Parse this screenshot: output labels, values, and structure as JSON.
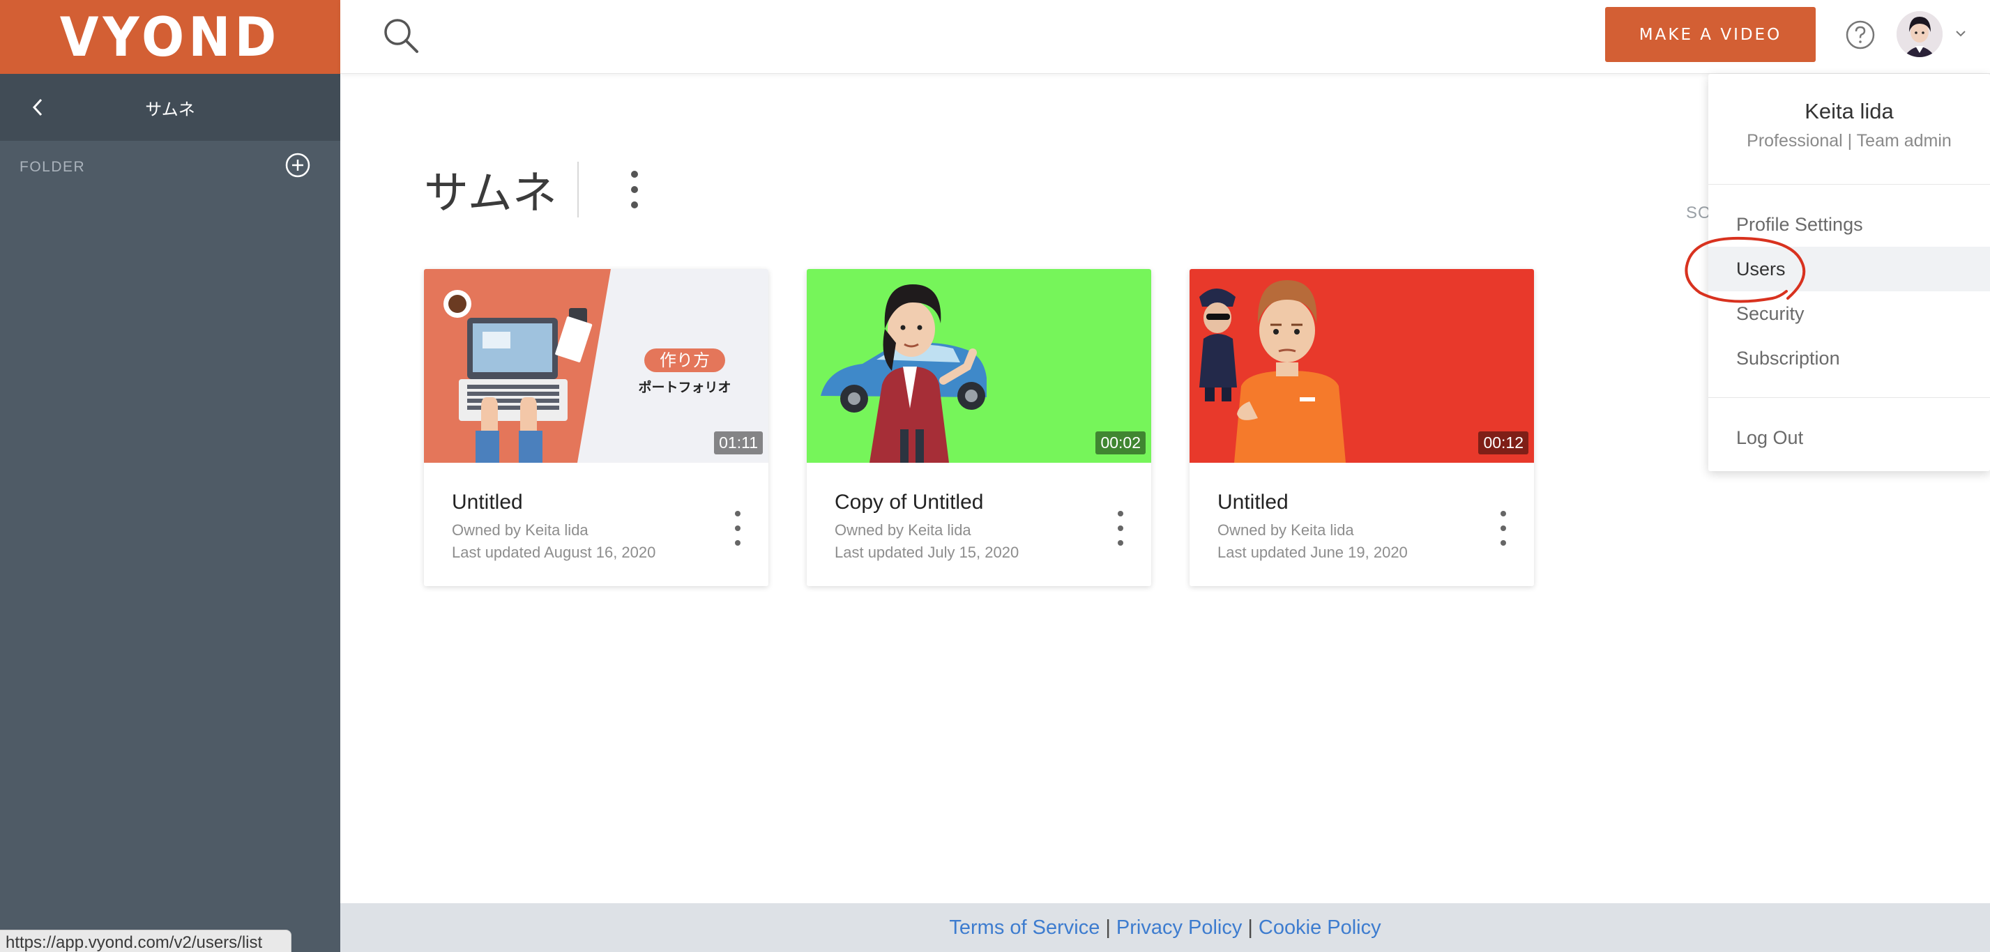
{
  "brand": {
    "logo": "VYOND"
  },
  "sidebar": {
    "folder_title": "サムネ",
    "folder_section_label": "FOLDER"
  },
  "status_bar": {
    "url": "https://app.vyond.com/v2/users/list"
  },
  "topbar": {
    "make_video_label": "MAKE A VIDEO"
  },
  "main": {
    "folder_title": "サムネ",
    "sort_label_peek": "SO",
    "videos": [
      {
        "title": "Untitled",
        "owner": "Owned by Keita lida",
        "updated": "Last updated August 16, 2020",
        "duration": "01:11",
        "thumb_caption_1": "作り方",
        "thumb_caption_2": "ポートフォリオ"
      },
      {
        "title": "Copy of Untitled",
        "owner": "Owned by Keita lida",
        "updated": "Last updated July 15, 2020",
        "duration": "00:02"
      },
      {
        "title": "Untitled",
        "owner": "Owned by Keita lida",
        "updated": "Last updated June 19, 2020",
        "duration": "00:12"
      }
    ]
  },
  "user_menu": {
    "name": "Keita lida",
    "role": "Professional | Team admin",
    "items": [
      {
        "label": "Profile Settings"
      },
      {
        "label": "Users"
      },
      {
        "label": "Security"
      },
      {
        "label": "Subscription"
      }
    ],
    "logout_label": "Log Out"
  },
  "footer": {
    "terms": "Terms of Service",
    "privacy": "Privacy Policy",
    "cookie": "Cookie Policy",
    "separator": "|"
  },
  "colors": {
    "brand_orange": "#d35f34",
    "sidebar": "#4f5b66",
    "link_blue": "#3d7ccf",
    "annotation_red": "#d8321f"
  },
  "icons": [
    "back-chevron-icon",
    "add-circle-icon",
    "search-icon",
    "help-icon",
    "chevron-down-icon",
    "more-vertical-icon"
  ]
}
